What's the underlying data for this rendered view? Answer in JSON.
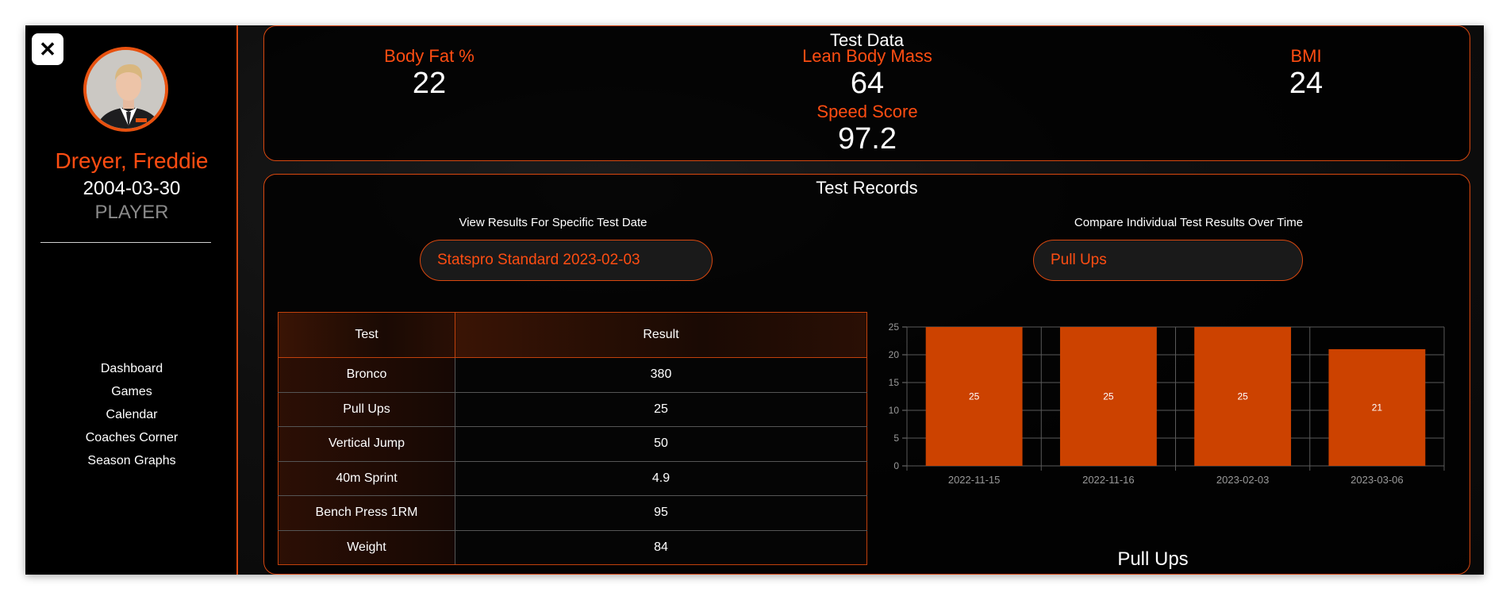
{
  "sidebar": {
    "close_symbol": "✕",
    "player": {
      "name": "Dreyer, Freddie",
      "dob": "2004-03-30",
      "role": "PLAYER"
    },
    "nav": [
      {
        "label": "Dashboard"
      },
      {
        "label": "Games"
      },
      {
        "label": "Calendar"
      },
      {
        "label": "Coaches Corner"
      },
      {
        "label": "Season Graphs"
      }
    ]
  },
  "test_data": {
    "title": "Test Data",
    "stats": [
      {
        "label": "Body Fat %",
        "value": "22"
      },
      {
        "label": "Lean Body Mass",
        "value": "64"
      },
      {
        "label": "BMI",
        "value": "24"
      },
      {
        "label": "Speed Score",
        "value": "97.2"
      }
    ]
  },
  "test_records": {
    "title": "Test Records",
    "date_select": {
      "label": "View Results For Specific Test Date",
      "value": "Statspro Standard 2023-02-03"
    },
    "compare_select": {
      "label": "Compare Individual Test Results Over Time",
      "value": "Pull Ups"
    },
    "table": {
      "headers": [
        "Test",
        "Result"
      ],
      "rows": [
        [
          "Bronco",
          "380"
        ],
        [
          "Pull Ups",
          "25"
        ],
        [
          "Vertical Jump",
          "50"
        ],
        [
          "40m Sprint",
          "4.9"
        ],
        [
          "Bench Press 1RM",
          "95"
        ],
        [
          "Weight",
          "84"
        ]
      ]
    }
  },
  "chart_data": {
    "type": "bar",
    "title": "Pull Ups",
    "categories": [
      "2022-11-15",
      "2022-11-16",
      "2023-02-03",
      "2023-03-06"
    ],
    "values": [
      25,
      25,
      25,
      21
    ],
    "ylim": [
      0,
      25
    ],
    "yticks": [
      0,
      5,
      10,
      15,
      20,
      25
    ],
    "bar_color": "#cc4200",
    "grid": true,
    "data_labels": true
  },
  "colors": {
    "accent": "#ff4d12",
    "border": "#d9480f",
    "bar": "#cc4200"
  }
}
